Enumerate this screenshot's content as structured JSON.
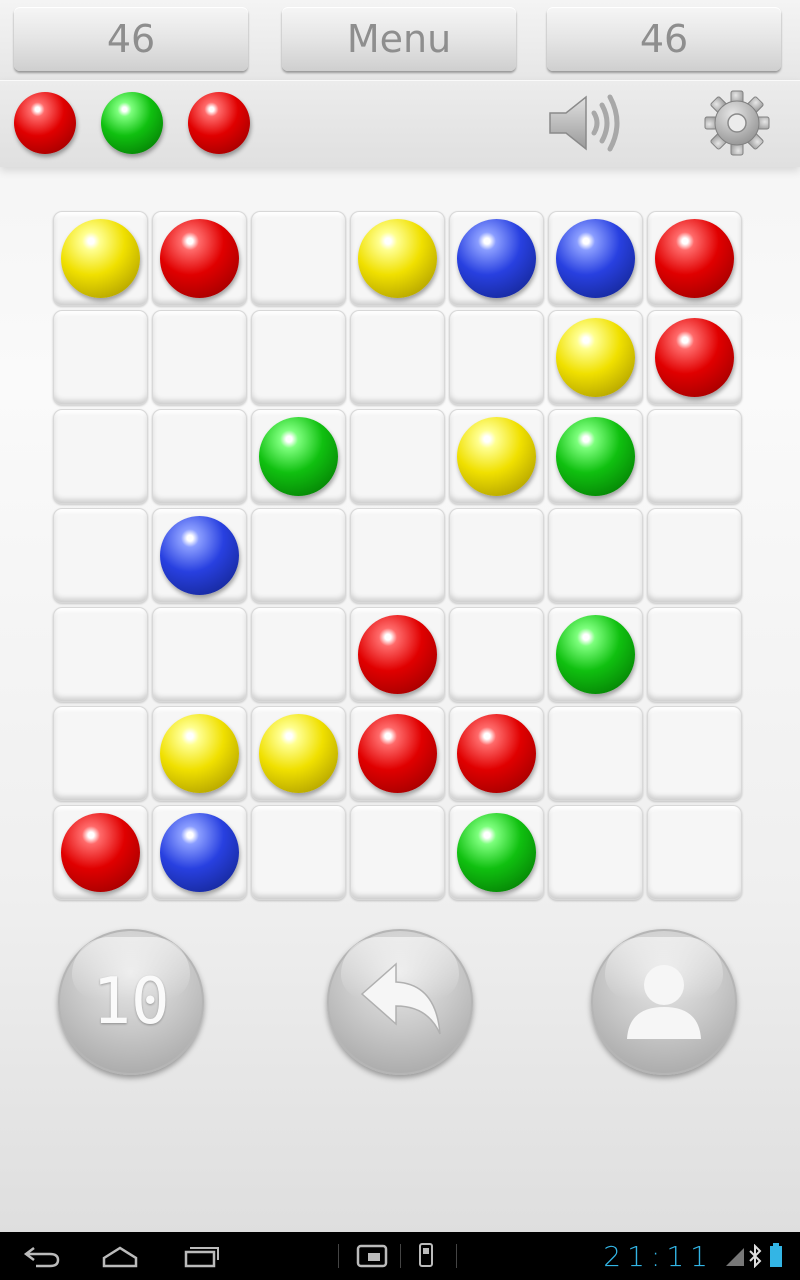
{
  "header": {
    "left_score": "46",
    "menu_label": "Menu",
    "right_score": "46"
  },
  "next_balls": [
    "red",
    "green",
    "red"
  ],
  "icons": {
    "sound": "speaker-icon",
    "settings": "gear-icon",
    "undo": "undo-arrow-icon",
    "profile": "person-icon"
  },
  "board": {
    "size": 7,
    "rows": [
      [
        "yellow",
        "red",
        "",
        "yellow",
        "blue",
        "blue",
        "red"
      ],
      [
        "",
        "",
        "",
        "",
        "",
        "yellow",
        "red"
      ],
      [
        "",
        "",
        "green",
        "",
        "yellow",
        "green",
        ""
      ],
      [
        "",
        "blue",
        "",
        "",
        "",
        "",
        ""
      ],
      [
        "",
        "",
        "",
        "red",
        "",
        "green",
        ""
      ],
      [
        "",
        "yellow",
        "yellow",
        "red",
        "red",
        "",
        ""
      ],
      [
        "red",
        "blue",
        "",
        "",
        "green",
        "",
        ""
      ]
    ]
  },
  "controls": {
    "level": "10"
  },
  "colors": {
    "red": "#e00000",
    "green": "#10c010",
    "yellow": "#f0e000",
    "blue": "#2840e0",
    "clock": "#33b5e5"
  },
  "status_bar": {
    "time": "21:11"
  }
}
